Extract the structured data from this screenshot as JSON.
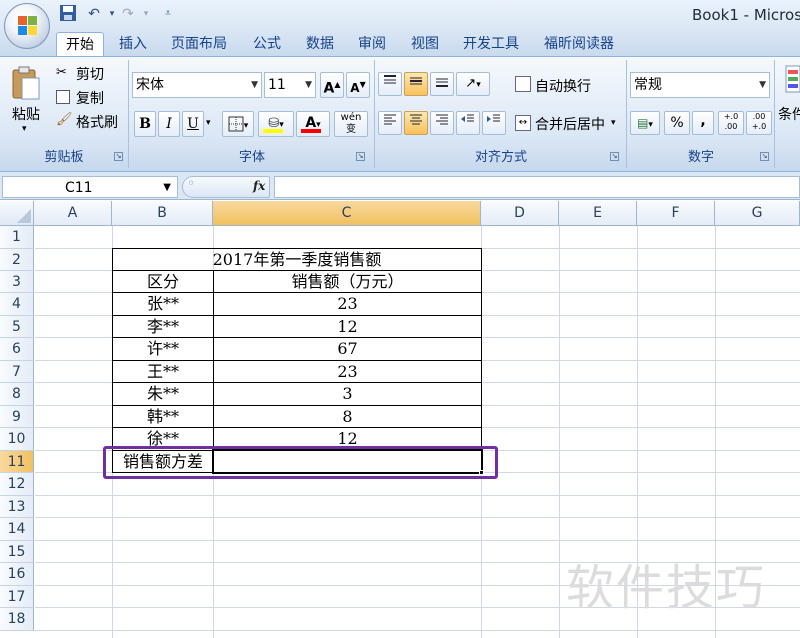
{
  "window": {
    "title": "Book1 - Micros"
  },
  "qat": {
    "save": "save-icon",
    "undo": "undo-icon",
    "redo": "redo-icon",
    "customize": "customize-icon"
  },
  "tabs": [
    "开始",
    "插入",
    "页面布局",
    "公式",
    "数据",
    "审阅",
    "视图",
    "开发工具",
    "福昕阅读器"
  ],
  "active_tab": "开始",
  "ribbon": {
    "clipboard": {
      "label": "剪贴板",
      "paste": "粘贴",
      "cut": "剪切",
      "copy": "复制",
      "format_painter": "格式刷"
    },
    "font": {
      "label": "字体",
      "font_name": "宋体",
      "font_size": "11",
      "grow": "A",
      "shrink": "A",
      "bold": "B",
      "italic": "I",
      "underline": "U",
      "font_color": "A",
      "phonetic": "wén 变"
    },
    "alignment": {
      "label": "对齐方式",
      "wrap_text": "自动换行",
      "merge_center": "合并后居中"
    },
    "number": {
      "label": "数字",
      "format": "常规",
      "percent": "%",
      "comma": ",",
      "inc_decimal": "+.0 .00",
      "dec_decimal": ".00 +.0"
    },
    "styles": {
      "cond_format": "条件"
    }
  },
  "formula_bar": {
    "name_box": "C11",
    "fx": "fx",
    "value": ""
  },
  "columns": [
    "A",
    "B",
    "C",
    "D",
    "E",
    "F",
    "G"
  ],
  "selected_column": "C",
  "rows": [
    "1",
    "2",
    "3",
    "4",
    "5",
    "6",
    "7",
    "8",
    "9",
    "10",
    "11",
    "12",
    "13",
    "14",
    "15",
    "16",
    "17",
    "18"
  ],
  "selected_row": "11",
  "table": {
    "title": "2017年第一季度销售额",
    "header": {
      "col1": "区分",
      "col2": "销售额（万元）"
    },
    "rows": [
      {
        "name": "张**",
        "value": "23"
      },
      {
        "name": "李**",
        "value": "12"
      },
      {
        "name": "许**",
        "value": "67"
      },
      {
        "name": "王**",
        "value": "23"
      },
      {
        "name": "朱**",
        "value": "3"
      },
      {
        "name": "韩**",
        "value": "8"
      },
      {
        "name": "徐**",
        "value": "12"
      }
    ],
    "footer_label": "销售额方差",
    "footer_value": ""
  },
  "colors": {
    "highlight_border": "#7030a0",
    "selected_header": "#f1c15f",
    "ribbon_text": "#15428b"
  },
  "watermark": "软件技巧"
}
